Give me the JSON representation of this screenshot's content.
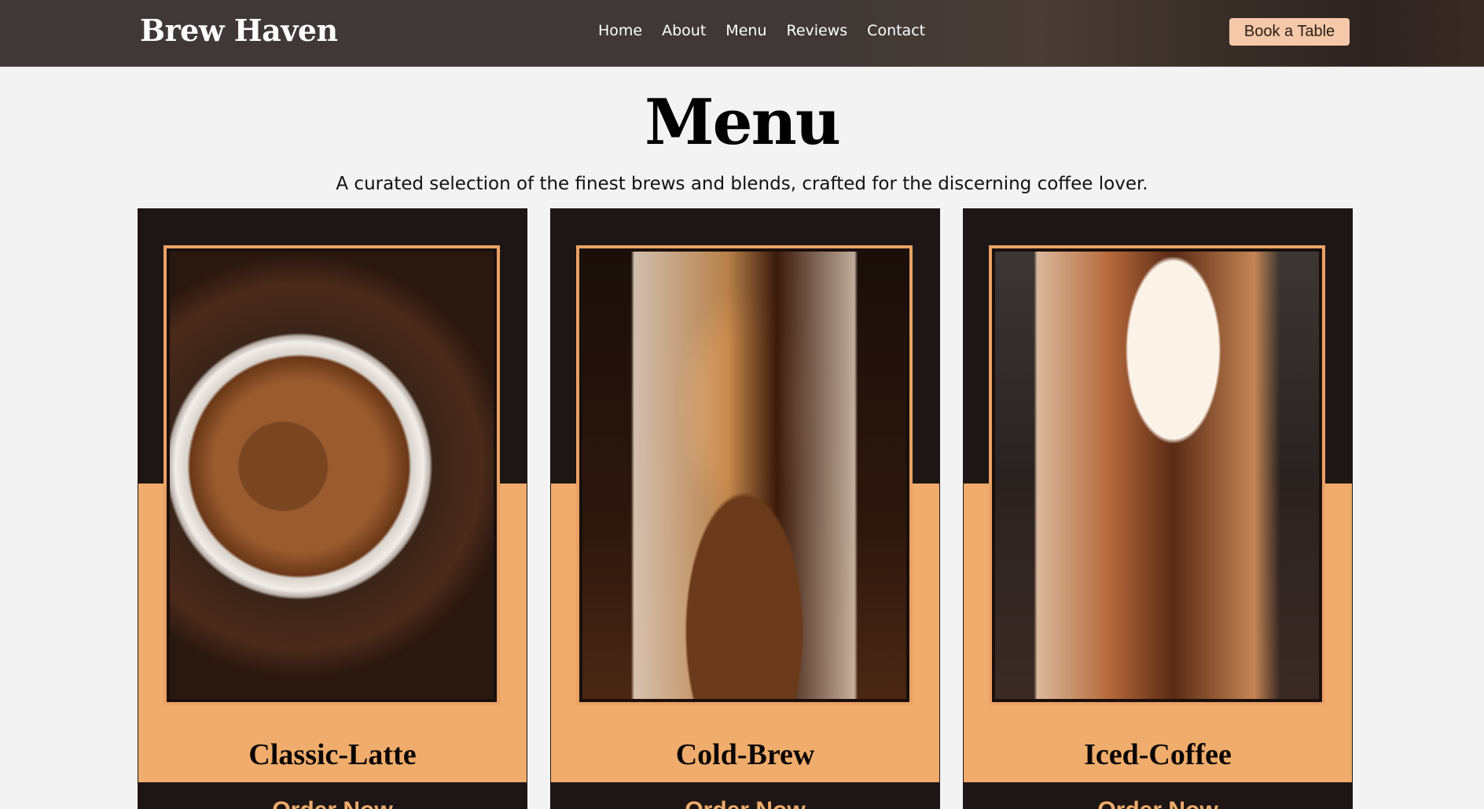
{
  "header": {
    "logo": "Brew Haven",
    "nav": [
      "Home",
      "About",
      "Menu",
      "Reviews",
      "Contact"
    ],
    "cta": "Book a Table"
  },
  "menu": {
    "title": "Menu",
    "subtitle": "A curated selection of the finest brews and blends, crafted for the discerning coffee lover."
  },
  "cards": [
    {
      "name": "Classic-Latte",
      "button": "Order Now"
    },
    {
      "name": "Cold-Brew",
      "button": "Order Now"
    },
    {
      "name": "Iced-Coffee",
      "button": "Order Now"
    }
  ],
  "colors": {
    "header_bg": "#3f3836",
    "accent": "#efac6c",
    "card_dark": "#1e1614",
    "cta_bg": "#f4c8a8"
  }
}
